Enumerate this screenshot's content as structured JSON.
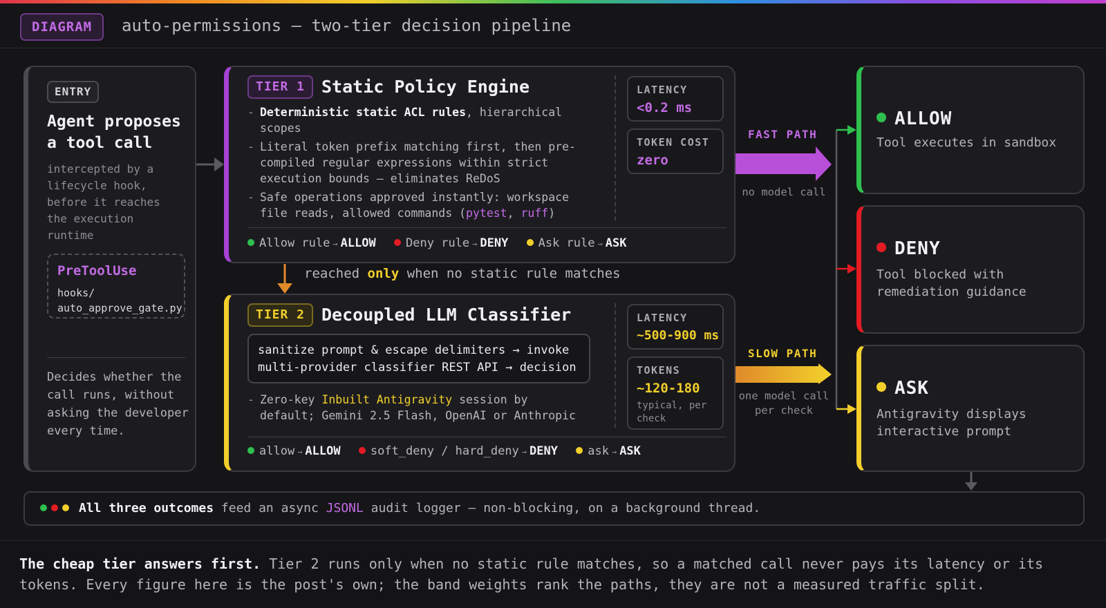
{
  "header": {
    "badge": "DIAGRAM",
    "title": "auto-permissions — two-tier decision pipeline"
  },
  "entry": {
    "badge": "ENTRY",
    "title": "Agent proposes a tool call",
    "description": "intercepted by a lifecycle hook, before it reaches the execution runtime",
    "hook_name": "PreToolUse",
    "hook_path": "hooks/ auto_approve_gate.py",
    "footnote": "Decides whether the call runs, without asking the developer every time."
  },
  "tier1": {
    "badge": "TIER 1",
    "title": "Static Policy Engine",
    "bullet1_strong": "Deterministic static ACL rules",
    "bullet1_rest": ", hierarchical scopes",
    "bullet2": "Literal token prefix matching first, then pre-compiled regular expressions within strict execution bounds — eliminates ReDoS",
    "bullet3_pre": "Safe operations approved instantly: workspace file reads, allowed commands (",
    "bullet3_cmd1": "pytest",
    "bullet3_sep": ", ",
    "bullet3_cmd2": "ruff",
    "bullet3_post": ")",
    "latency_label": "LATENCY",
    "latency_value": "<0.2 ms",
    "cost_label": "TOKEN COST",
    "cost_value": "zero",
    "outcomes": [
      {
        "rule": "Allow rule",
        "result": "ALLOW",
        "color": "#2fbf4e"
      },
      {
        "rule": "Deny rule",
        "result": "DENY",
        "color": "#e31b23"
      },
      {
        "rule": "Ask rule",
        "result": "ASK",
        "color": "#f2cf2b"
      }
    ]
  },
  "between": {
    "pre": "reached ",
    "emph": "only",
    "post": " when no static rule matches"
  },
  "tier2": {
    "badge": "TIER 2",
    "title": "Decoupled LLM Classifier",
    "pipeline_line1": "sanitize prompt & escape delimiters → invoke",
    "pipeline_line2": "multi-provider classifier REST API → decision",
    "bullet_pre": "Zero-key ",
    "bullet_emph": "Inbuilt Antigravity",
    "bullet_post": " session by default; Gemini 2.5 Flash, OpenAI or Anthropic",
    "latency_label": "LATENCY",
    "latency_value": "~500-900 ms",
    "tokens_label": "TOKENS",
    "tokens_value": "~120-180",
    "tokens_sub": "typical, per check",
    "outcomes": [
      {
        "rule": "allow",
        "result": "ALLOW",
        "color": "#2fbf4e"
      },
      {
        "rule": "soft_deny / hard_deny",
        "result": "DENY",
        "color": "#e31b23"
      },
      {
        "rule": "ask",
        "result": "ASK",
        "color": "#f2cf2b"
      }
    ]
  },
  "fast_path": {
    "label": "FAST PATH",
    "note": "no model call"
  },
  "slow_path": {
    "label": "SLOW PATH",
    "note": "one model call per check"
  },
  "outputs": {
    "allow": {
      "title": "ALLOW",
      "desc": "Tool executes in sandbox",
      "color": "#2fbf4e"
    },
    "deny": {
      "title": "DENY",
      "desc": "Tool blocked with remediation guidance",
      "color": "#e31b23"
    },
    "ask": {
      "title": "ASK",
      "desc": "Antigravity displays interactive prompt",
      "color": "#f2cf2b"
    }
  },
  "audit": {
    "strong": "All three outcomes",
    "pre": " feed an async ",
    "emph": "JSONL",
    "post": " audit logger — non-blocking, on a background thread."
  },
  "footer": {
    "strong": "The cheap tier answers first.",
    "text": " Tier 2 runs only when no static rule matches, so a matched call never pays its latency or its tokens. Every figure here is the post's own; the band weights rank the paths, they are not a measured traffic split."
  },
  "colors": {
    "purple": "#a642d4",
    "yellow": "#f2cf2b",
    "green": "#2fbf4e",
    "red": "#e31b23"
  }
}
